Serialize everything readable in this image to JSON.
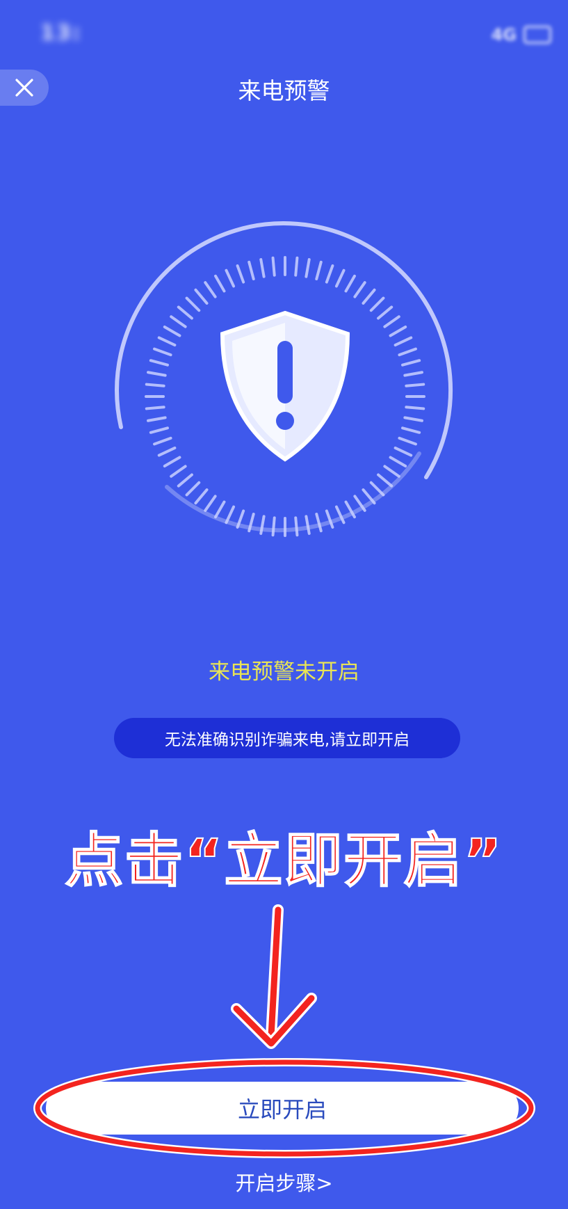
{
  "status_bar": {
    "time": "13:",
    "network": "4G"
  },
  "header": {
    "close_icon": "close-icon",
    "title": "来电预警"
  },
  "main": {
    "shield_icon": "shield-exclamation-icon",
    "status_text": "来电预警未开启",
    "hint_text": "无法准确识别诈骗来电,请立即开启"
  },
  "annotation": {
    "text": "点击“立即开启”",
    "color": "#f3241f"
  },
  "footer": {
    "open_button_label": "立即开启",
    "steps_link": "开启步骤>"
  },
  "colors": {
    "background": "#3f59ec",
    "status_text": "#e9e455",
    "hint_pill": "#1e2fd6",
    "button_text": "#2a4bbd"
  }
}
